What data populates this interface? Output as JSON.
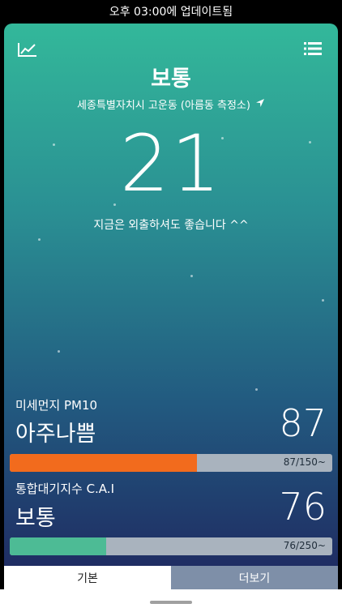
{
  "status_bar": {
    "text": "오후 03:00에 업데이트됨"
  },
  "header": {
    "chart_icon": "chart-trend-icon",
    "list_icon": "list-menu-icon"
  },
  "main": {
    "grade": "보통",
    "location": "세종특별자치시 고운동 (아름동 측정소)",
    "location_icon": "location-arrow-icon",
    "value": "21",
    "message": "지금은 외출하셔도 좋습니다 ^^"
  },
  "metrics": [
    {
      "label": "미세먼지 PM10",
      "status": "아주나쁨",
      "value": "87",
      "bar_text": "87/150~",
      "fill_fraction": 0.58,
      "fill_color": "#f26b1d"
    },
    {
      "label": "통합대기지수 C.A.I",
      "status": "보통",
      "value": "76",
      "bar_text": "76/250~",
      "fill_fraction": 0.3,
      "fill_color": "#4dbb95"
    }
  ],
  "tabs": {
    "basic": "기본",
    "more": "더보기"
  },
  "colors": {
    "gradient_top": "#33b89a",
    "gradient_bottom": "#1f2d63",
    "bar_track": "#a9b3be",
    "tab_more_bg": "#7e8fa8"
  }
}
